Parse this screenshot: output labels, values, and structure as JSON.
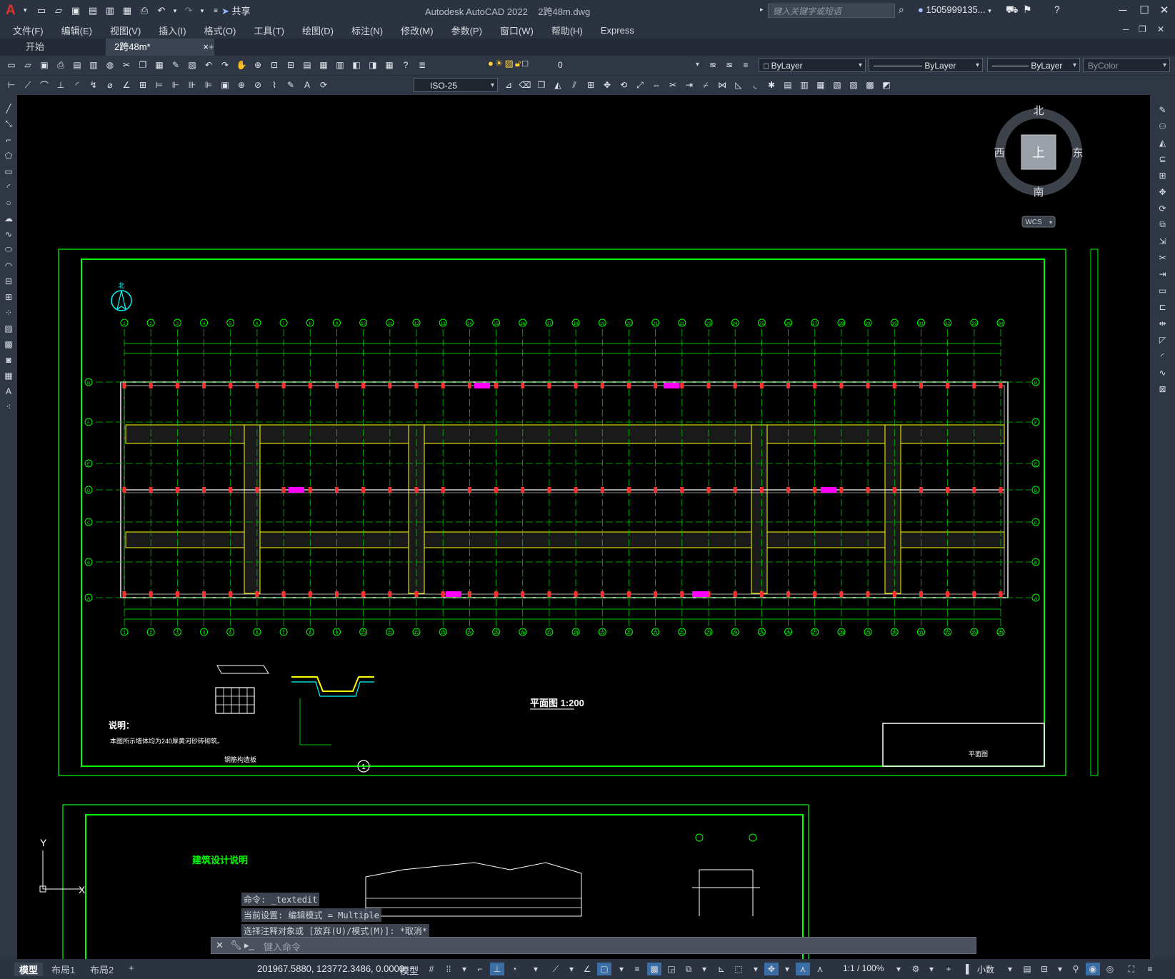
{
  "app": {
    "logo_letter": "A",
    "title": "Autodesk AutoCAD 2022",
    "filename": "2跨48m.dwg",
    "share_label": "共享",
    "search_placeholder": "键入关键字或短语",
    "user": "1505999135..."
  },
  "menu": [
    "文件(F)",
    "编辑(E)",
    "视图(V)",
    "插入(I)",
    "格式(O)",
    "工具(T)",
    "绘图(D)",
    "标注(N)",
    "修改(M)",
    "参数(P)",
    "窗口(W)",
    "帮助(H)",
    "Express"
  ],
  "tabs": {
    "start": "开始",
    "active": "2跨48m*",
    "close": "×",
    "add": "+"
  },
  "properties": {
    "layer": "0",
    "color": "ByLayer",
    "linetype": "ByLayer",
    "lineweight": "ByLayer",
    "plotstyle": "ByColor",
    "dimstyle": "ISO-25"
  },
  "viewcube": {
    "north": "北",
    "south": "南",
    "east": "东",
    "west": "西",
    "top": "上",
    "wcs": "WCS"
  },
  "drawing": {
    "north_label": "北",
    "plan_title": "平面图 1:200",
    "notes_heading": "说明：",
    "notes_text": "本图所示墙体均为240厚黄河砂砖砌筑。",
    "sheet_title": "平面图",
    "detail_caption": "钢筋构造板",
    "detail_marker": "1",
    "section_title": "建筑设计说明",
    "axis_top": [
      "1",
      "2",
      "3",
      "4",
      "5",
      "6",
      "7",
      "8",
      "9",
      "10",
      "11",
      "12",
      "13",
      "14",
      "15",
      "16",
      "17",
      "18",
      "19",
      "20",
      "21",
      "22",
      "23",
      "24",
      "25",
      "26",
      "27",
      "28",
      "29",
      "30",
      "31",
      "32",
      "33",
      "34"
    ],
    "axis_side": [
      "G",
      "F",
      "E",
      "D",
      "C",
      "B",
      "A"
    ],
    "ucs_y": "Y",
    "ucs_x": "X"
  },
  "command": {
    "history": [
      "命令: _textedit",
      "当前设置: 编辑模式 = Multiple",
      "选择注释对象或 [放弃(U)/模式(M)]: *取消*"
    ],
    "placeholder": "键入命令"
  },
  "status": {
    "layouts": [
      "模型",
      "布局1",
      "布局2"
    ],
    "coords": "201967.5880, 123772.3486, 0.0000",
    "model": "模型",
    "scale": "1:1 / 100%",
    "units": "小数"
  },
  "colors": {
    "frame_green": "#00ff00",
    "grid_green": "#00c800",
    "cyan": "#00ffff",
    "magenta": "#ff00ff",
    "yellow": "#ffff00",
    "red": "#ff3030",
    "white": "#ffffff"
  }
}
